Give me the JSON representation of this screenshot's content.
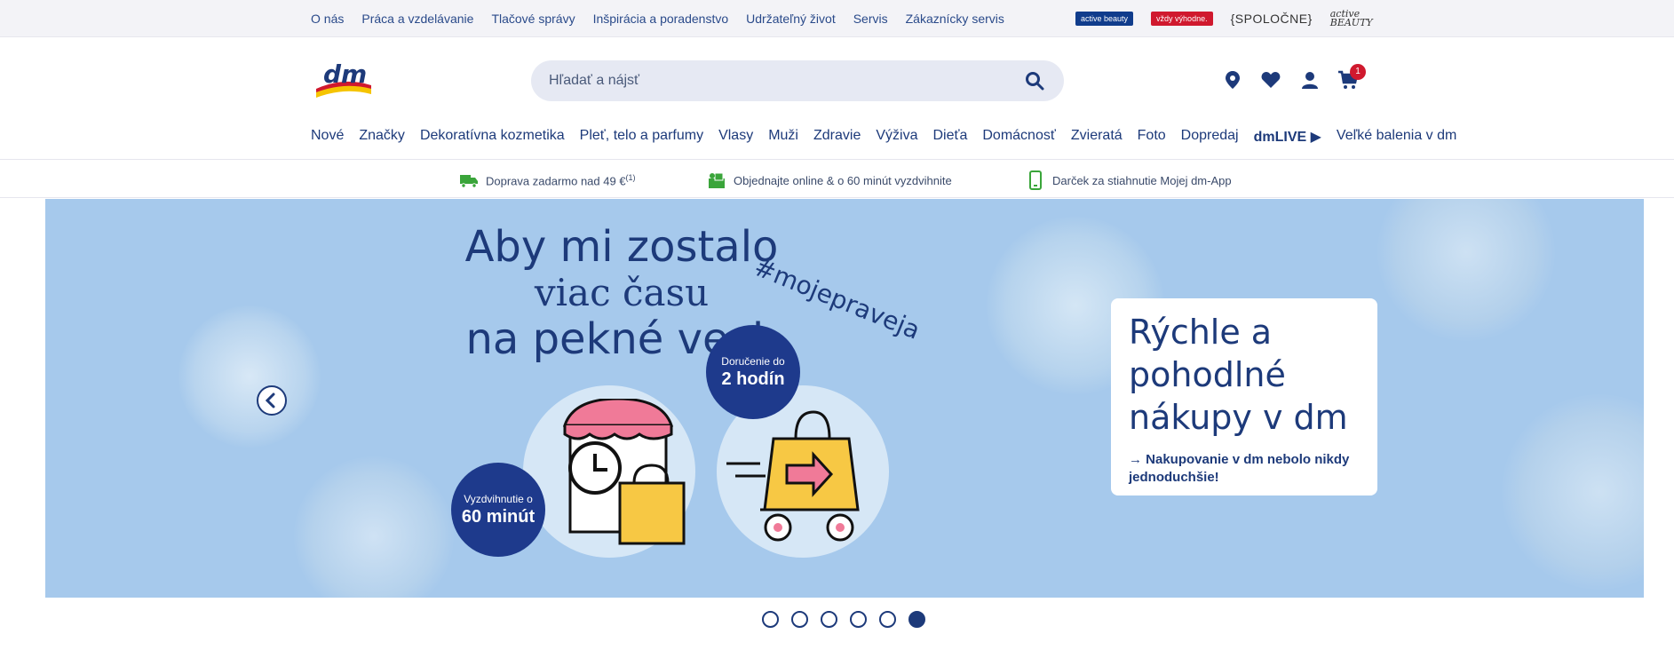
{
  "topbar": {
    "links": [
      "O nás",
      "Práca a vzdelávanie",
      "Tlačové správy",
      "Inšpirácia a poradenstvo",
      "Udržateľný život",
      "Servis",
      "Zákaznícky servis"
    ],
    "brands": {
      "active": "active beauty",
      "vyhodne": "vždy výhodne.",
      "spolocne": "{SPOLOČNE}",
      "beauty_top": "active",
      "beauty_bottom": "BEAUTY"
    }
  },
  "header": {
    "search_placeholder": "Hľadať a nájsť",
    "cart_count": "1",
    "icons": [
      "location-pin-icon",
      "heart-icon",
      "user-icon",
      "cart-icon"
    ],
    "accent": "#1d3a7a"
  },
  "nav": {
    "items": [
      "Nové",
      "Značky",
      "Dekoratívna kozmetika",
      "Pleť, telo a parfumy",
      "Vlasy",
      "Muži",
      "Zdravie",
      "Výživa",
      "Dieťa",
      "Domácnosť",
      "Zvieratá",
      "Foto",
      "Dopredaj"
    ],
    "live": "dmLIVE ▶",
    "last": "Veľké balenia v dm"
  },
  "infobar": {
    "shipping": "Doprava zadarmo nad 49 €",
    "shipping_note": "(1)",
    "pickup": "Objednajte online & o 60 minút vyzdvihnite",
    "app": "Darček za stiahnutie Mojej dm-App",
    "icon_color": "#3aa53a"
  },
  "banner": {
    "headline_1": "Aby mi zostalo",
    "headline_2": "viac času",
    "headline_3": "na pekné veci.",
    "hashtag": "#mojepraveja",
    "badge_delivery_small": "Doručenie do",
    "badge_delivery_big": "2 hodín",
    "badge_pickup_small": "Vyzdvihnutie o",
    "badge_pickup_big": "60 minút",
    "promo_title": "Rýchle a pohodlné nákupy v dm",
    "promo_link": "→ Nakupovanie v dm nebolo nikdy jednoduchšie!",
    "bg_color": "#a6c9ec"
  },
  "carousel": {
    "total": 6,
    "active_index": 5
  }
}
